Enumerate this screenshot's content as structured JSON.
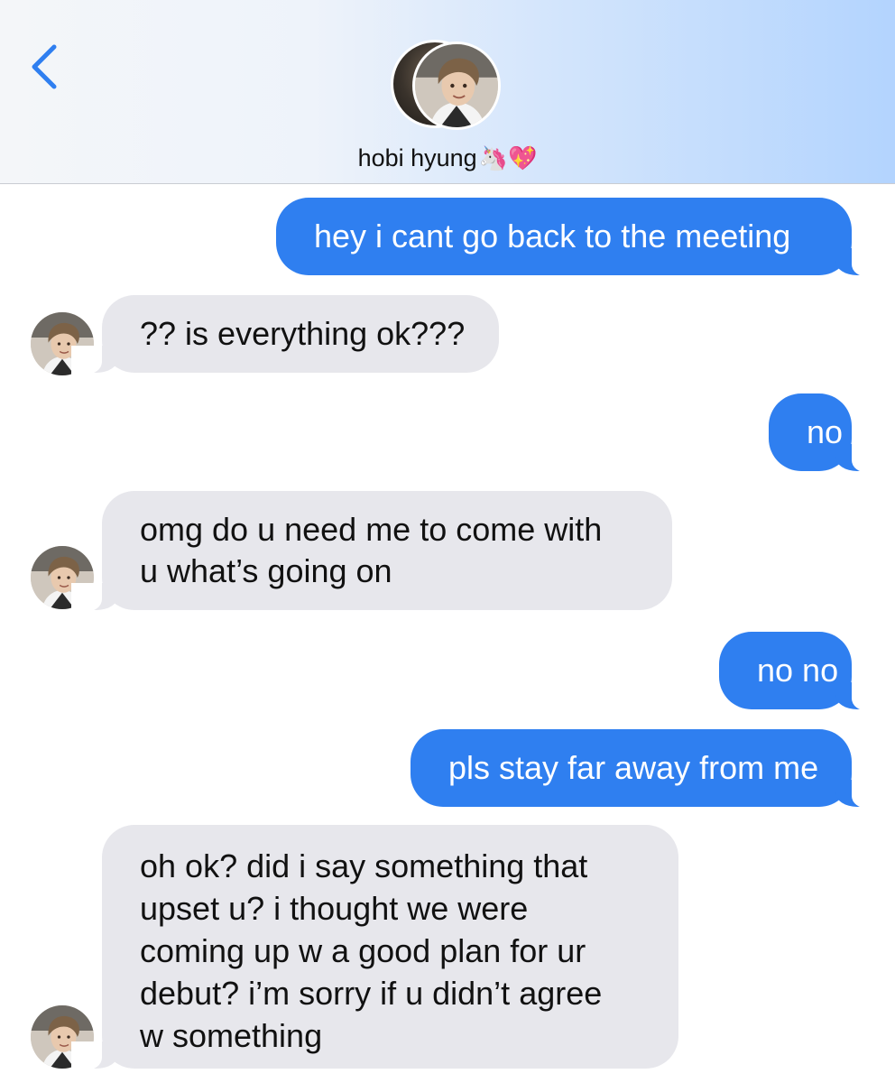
{
  "header": {
    "back_icon": "chevron-left-icon",
    "contact_name": "hobi hyung",
    "contact_emoji": "🦄💖",
    "accent_color": "#2f7ff0"
  },
  "messages": [
    {
      "side": "sent",
      "lines": [
        "hey i cant go back to the meeting"
      ]
    },
    {
      "side": "received",
      "lines": [
        "?? is everything ok???"
      ]
    },
    {
      "side": "sent",
      "lines": [
        "no"
      ]
    },
    {
      "side": "received",
      "lines": [
        "omg do u need me to come with",
        "u what’s going on"
      ]
    },
    {
      "side": "sent",
      "lines": [
        "no no"
      ]
    },
    {
      "side": "sent",
      "lines": [
        "pls stay far away from me"
      ]
    },
    {
      "side": "received",
      "lines": [
        "oh ok? did i say something that",
        "upset u? i thought we were",
        "coming up w a good plan for ur",
        "debut? i’m sorry if u didn’t agree",
        "w something"
      ]
    }
  ]
}
